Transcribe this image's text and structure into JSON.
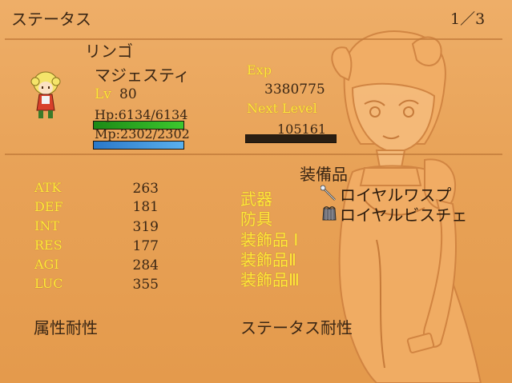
{
  "header": {
    "title": "ステータス",
    "page": "1／3"
  },
  "actor": {
    "name": "リンゴ",
    "class_name": "マジェスティ",
    "level_label": "Lv",
    "level": "80",
    "hp_text": "Hp:6134/6134",
    "hp_fraction": 1.0,
    "mp_text": "Mp:2302/2302",
    "mp_fraction": 1.0,
    "exp_label": "Exp",
    "exp_value": "3380775",
    "next_label": "Next Level",
    "next_value": "105161",
    "next_fraction": 0.0
  },
  "stats": [
    {
      "label": "ATK",
      "value": "263"
    },
    {
      "label": "DEF",
      "value": "181"
    },
    {
      "label": "INT",
      "value": "319"
    },
    {
      "label": "RES",
      "value": "177"
    },
    {
      "label": "AGI",
      "value": "284"
    },
    {
      "label": "LUC",
      "value": "355"
    }
  ],
  "equipment": {
    "title": "装備品",
    "slots": [
      "武器",
      "防具",
      "装飾品 Ⅰ",
      "装飾品Ⅱ",
      "装飾品Ⅲ"
    ],
    "items": [
      {
        "name": "ロイヤルワスプ",
        "icon": "wand-icon"
      },
      {
        "name": "ロイヤルビスチェ",
        "icon": "bustier-icon"
      }
    ]
  },
  "resist": {
    "element_title": "属性耐性",
    "status_title": "ステータス耐性"
  },
  "colors": {
    "hp": "#26a81e",
    "mp": "#3c8fd8",
    "label": "#ffe93a",
    "text": "#3a2614"
  }
}
